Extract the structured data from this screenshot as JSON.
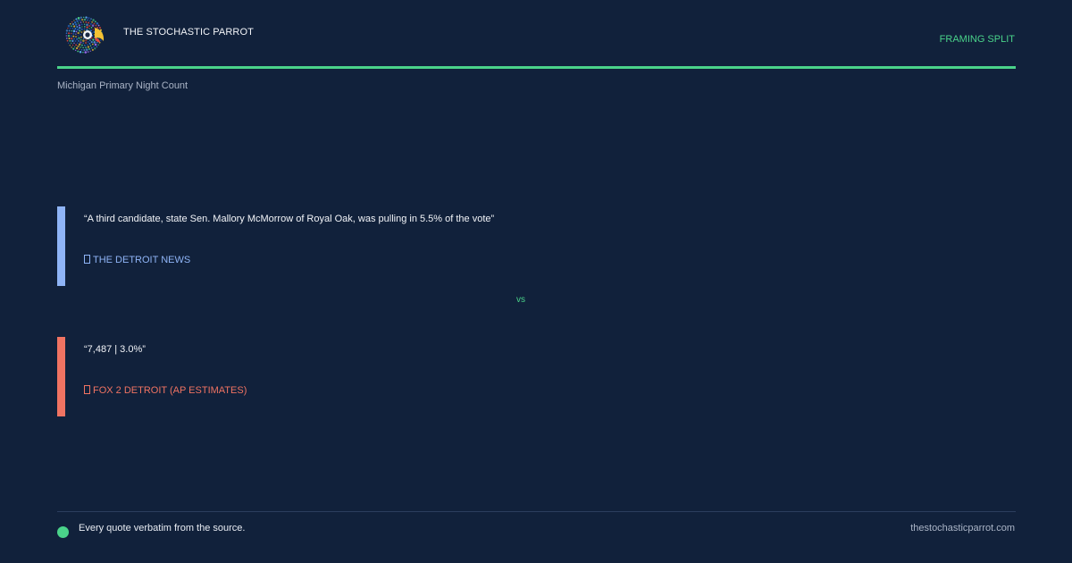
{
  "header": {
    "brand": "THE STOCHASTIC PARROT",
    "tag": "FRAMING SPLIT",
    "logo_icon": "parrot-logo-icon"
  },
  "subtitle": "Michigan Primary Night Count",
  "quotes": [
    {
      "text": "“A third candidate, state Sen. Mallory McMorrow of Royal Oak, was pulling in 5.5% of the vote”",
      "source": "THE DETROIT NEWS",
      "accent": "#8fb4f6"
    },
    {
      "text": "“7,487 | 3.0%”",
      "source": "FOX 2 DETROIT (AP ESTIMATES)",
      "accent": "#f07362"
    }
  ],
  "vs_label": "vs",
  "footer": {
    "note": "Every quote verbatim from the source.",
    "url": "thestochasticparrot.com"
  },
  "colors": {
    "background": "#11213b",
    "accent_green": "#4ad38a"
  }
}
